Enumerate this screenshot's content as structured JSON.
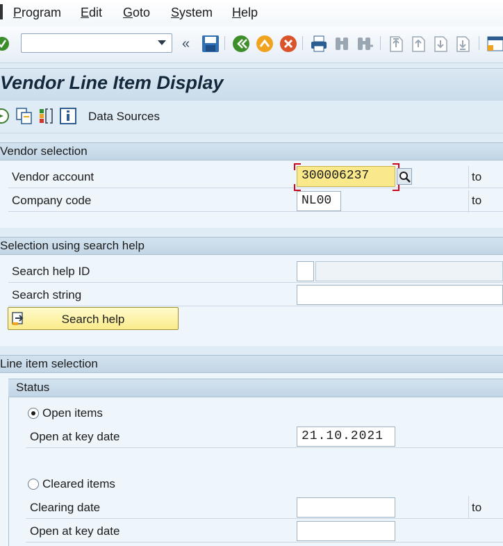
{
  "menu": {
    "items": [
      "Program",
      "Edit",
      "Goto",
      "System",
      "Help"
    ],
    "first_letters": [
      "P",
      "E",
      "G",
      "S",
      "H"
    ],
    "rests": [
      "rogram",
      "dit",
      "oto",
      "ystem",
      "elp"
    ]
  },
  "toolbar": {
    "command_value": "",
    "icons": [
      "enter-check-icon",
      "command-dropdown-icon",
      "collapse-icon",
      "save-icon",
      "back-icon",
      "exit-icon",
      "cancel-icon",
      "print-icon",
      "find-icon",
      "find-next-icon",
      "first-page-icon",
      "previous-page-icon",
      "next-page-icon",
      "last-page-icon",
      "layout-icon"
    ]
  },
  "title": {
    "text": "Vendor Line Item Display"
  },
  "app_toolbar": {
    "data_sources_label": "Data Sources",
    "icons": [
      "execute-icon",
      "get-variant-icon",
      "dynamic-selections-icon",
      "info-icon"
    ]
  },
  "vendor_selection": {
    "title": "Vendor selection",
    "vendor_account_label": "Vendor account",
    "vendor_account_value": "300006237",
    "company_code_label": "Company code",
    "company_code_value": "NL00",
    "to_label": "to"
  },
  "search_help": {
    "title": "Selection using search help",
    "id_label": "Search help ID",
    "string_label": "Search string",
    "button_label": "Search help"
  },
  "line_item": {
    "title": "Line item selection",
    "status_title": "Status",
    "open_items_label": "Open items",
    "open_at_key_date_label": "Open at key date",
    "open_at_key_date_value": "21.10.2021",
    "cleared_items_label": "Cleared items",
    "clearing_date_label": "Clearing date",
    "cleared_open_at_key_date_label": "Open at key date",
    "to_label": "to"
  },
  "colors": {
    "accent": "#f9e98b",
    "required_marker": "#d0021b",
    "background": "#dfebf5"
  }
}
